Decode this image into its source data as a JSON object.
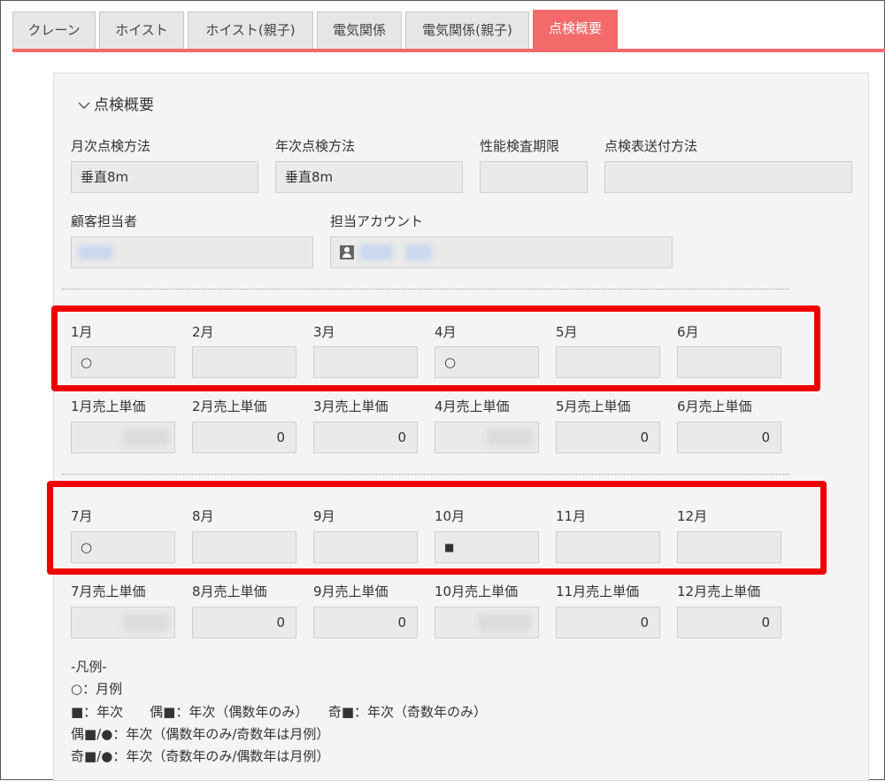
{
  "tabs": [
    "クレーン",
    "ホイスト",
    "ホイスト(親子)",
    "電気関係",
    "電気関係(親子)",
    "点検概要"
  ],
  "section": {
    "title": "点検概要",
    "chevron": "chevron-down-icon"
  },
  "fields": {
    "monthly_method": {
      "label": "月次点検方法",
      "value": "垂直8m"
    },
    "annual_method": {
      "label": "年次点検方法",
      "value": "垂直8m"
    },
    "performance_period": {
      "label": "性能検査期限",
      "value": ""
    },
    "sheet_delivery": {
      "label": "点検表送付方法",
      "value": ""
    },
    "customer_contact": {
      "label": "顧客担当者"
    },
    "account": {
      "label": "担当アカウント",
      "icon": "person-icon"
    }
  },
  "months_h1": [
    {
      "label": "1月",
      "mark": "○",
      "price_label": "1月売上単価",
      "price": ""
    },
    {
      "label": "2月",
      "mark": "",
      "price_label": "2月売上単価",
      "price": "0"
    },
    {
      "label": "3月",
      "mark": "",
      "price_label": "3月売上単価",
      "price": "0"
    },
    {
      "label": "4月",
      "mark": "○",
      "price_label": "4月売上単価",
      "price": ""
    },
    {
      "label": "5月",
      "mark": "",
      "price_label": "5月売上単価",
      "price": "0"
    },
    {
      "label": "6月",
      "mark": "",
      "price_label": "6月売上単価",
      "price": "0"
    }
  ],
  "months_h2": [
    {
      "label": "7月",
      "mark": "○",
      "price_label": "7月売上単価",
      "price": ""
    },
    {
      "label": "8月",
      "mark": "",
      "price_label": "8月売上単価",
      "price": "0"
    },
    {
      "label": "9月",
      "mark": "",
      "price_label": "9月売上単価",
      "price": "0"
    },
    {
      "label": "10月",
      "mark": "■",
      "price_label": "10月売上単価",
      "price": ""
    },
    {
      "label": "11月",
      "mark": "",
      "price_label": "11月売上単価",
      "price": "0"
    },
    {
      "label": "12月",
      "mark": "",
      "price_label": "12月売上単価",
      "price": "0"
    }
  ],
  "legend": [
    "-凡例-",
    "○：月例",
    "■：年次　　偶■：年次（偶数年のみ）　　奇■：年次（奇数年のみ）",
    "偶■/●：年次（偶数年のみ/奇数年は月例）",
    "奇■/●：年次（奇数年のみ/偶数年は月例）"
  ],
  "colors": {
    "accent": "#f36a6a",
    "highlight": "#ee0000"
  }
}
